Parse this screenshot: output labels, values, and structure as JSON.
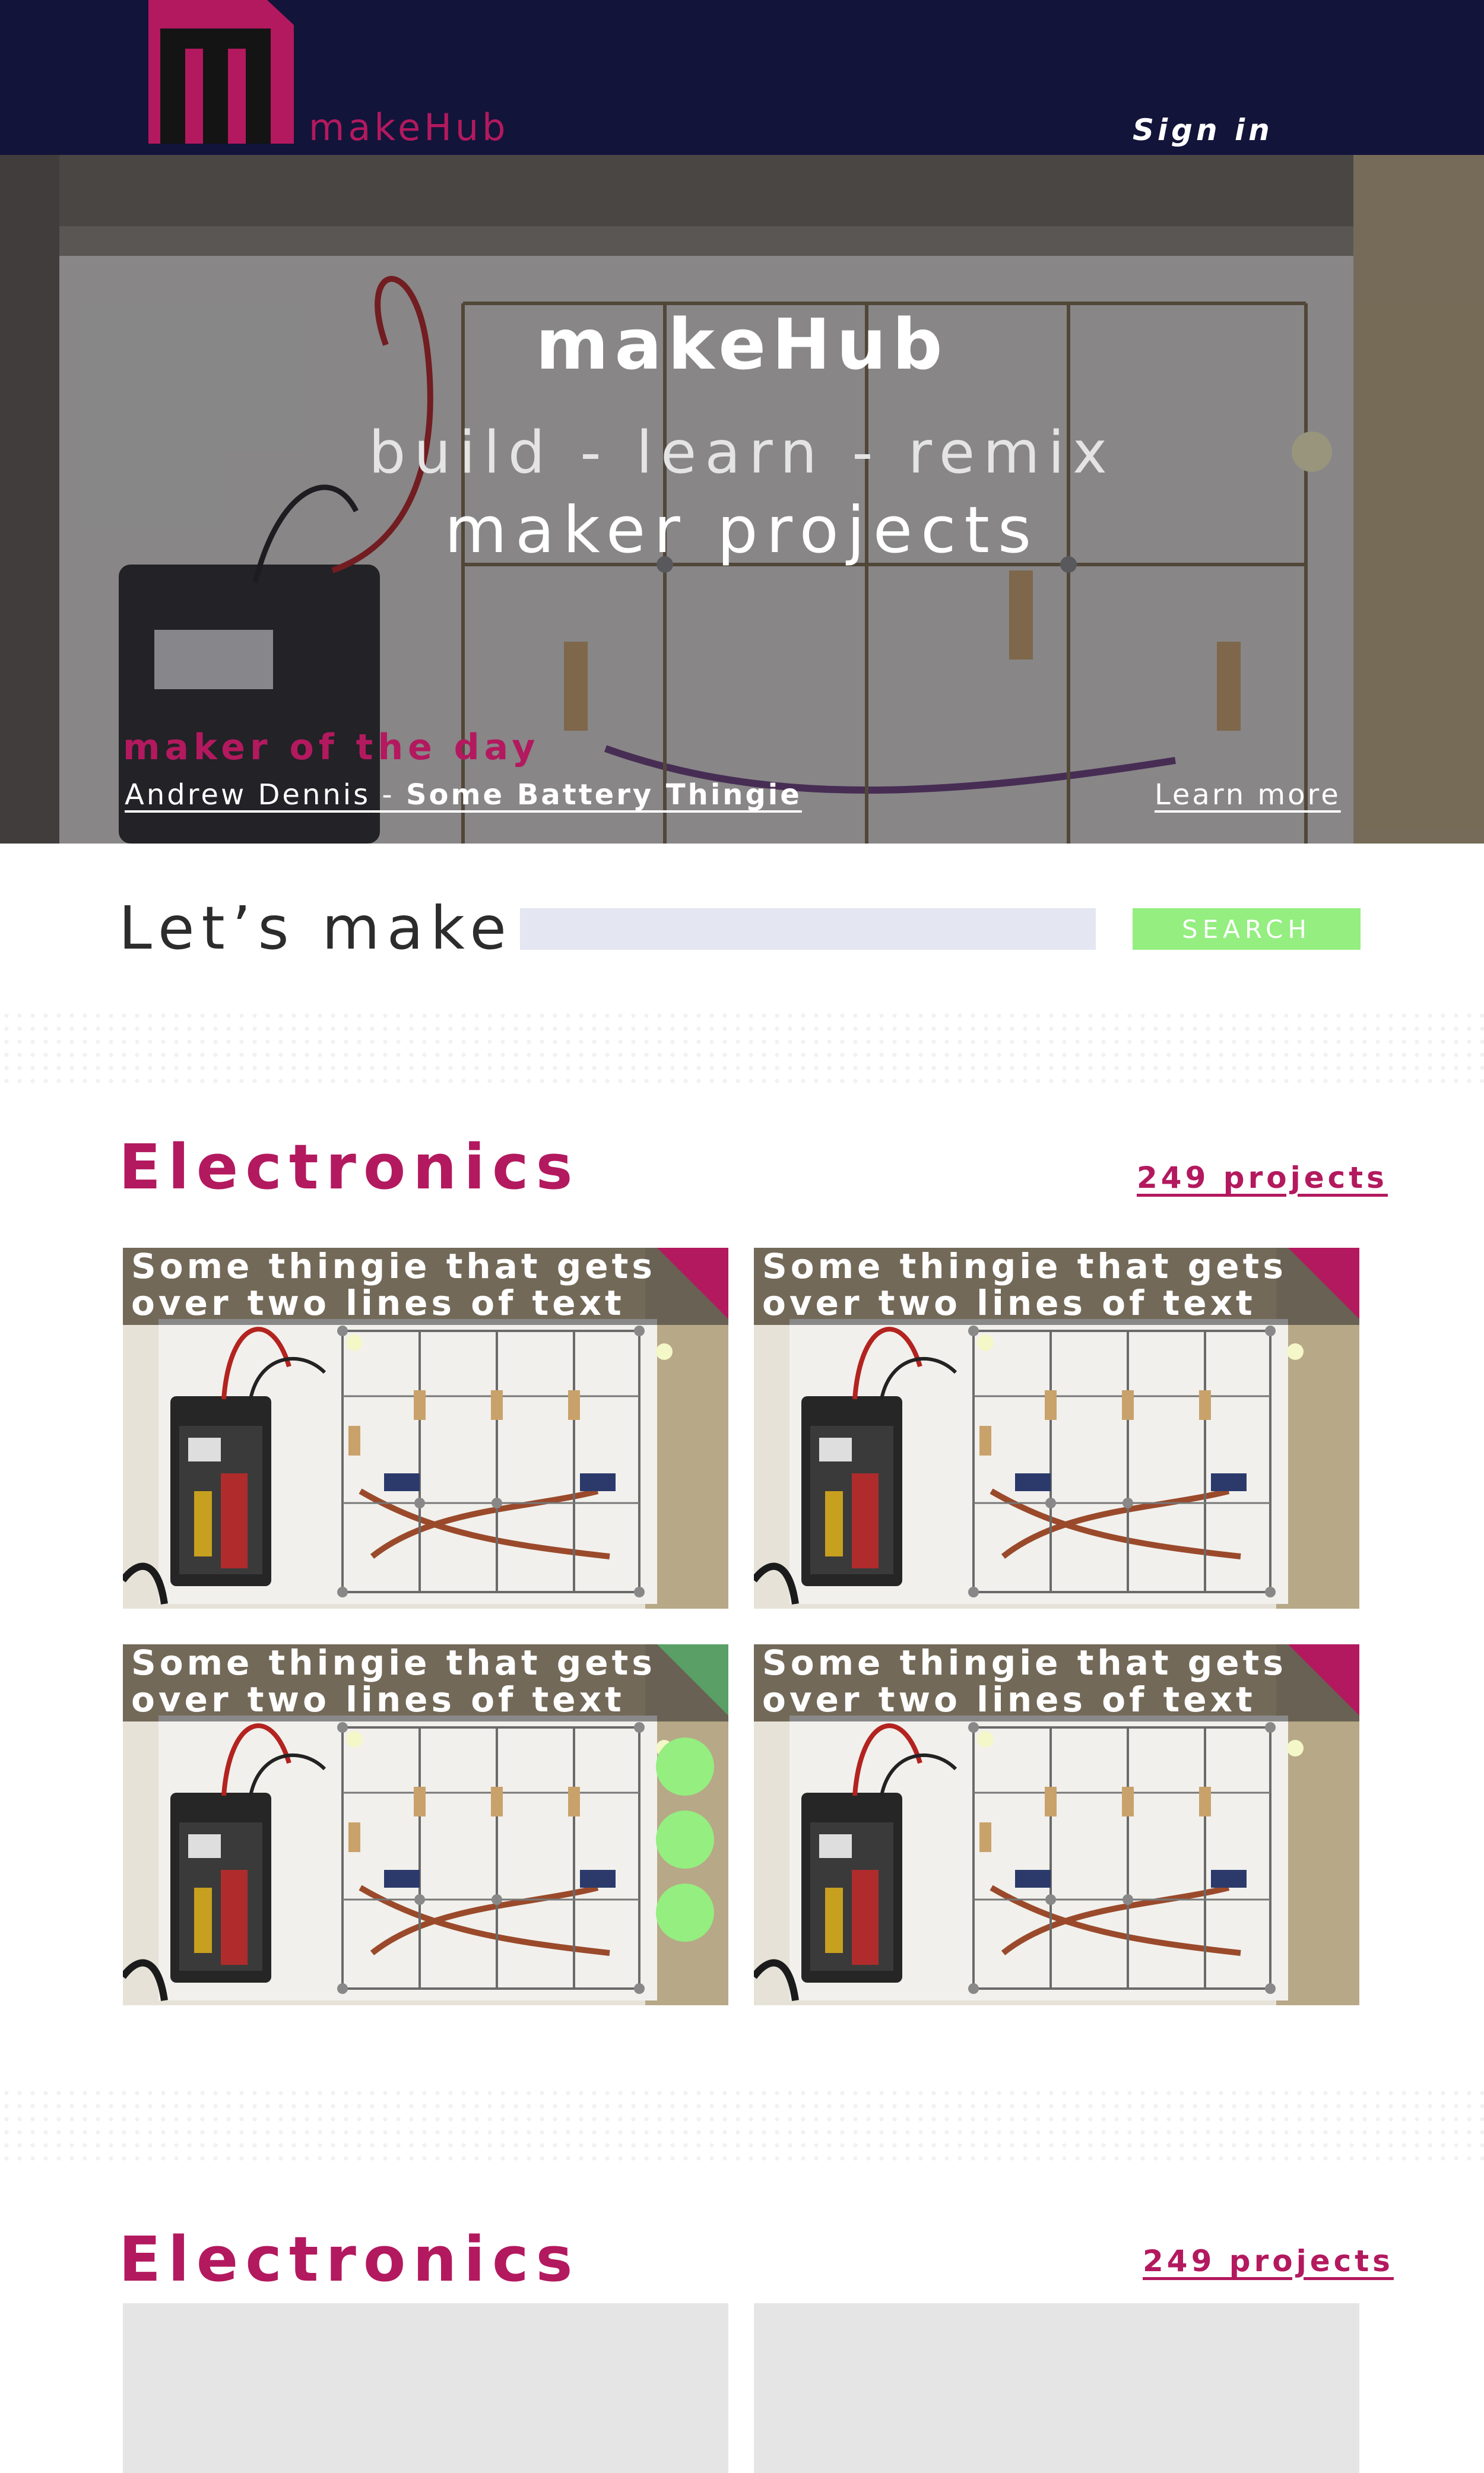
{
  "header": {
    "logo_text": "makeHub",
    "signin_label": "Sign in",
    "colors": {
      "background": "#12143a",
      "brand": "#b3195e"
    }
  },
  "hero": {
    "title": "makeHub",
    "tagline": "build - learn - remix",
    "subtitle": "maker projects",
    "maker_of_the_day": {
      "label": "maker of the day",
      "author": "Andrew Dennis",
      "separator": " - ",
      "project": "Some Battery Thingie"
    },
    "learn_more_label": "Learn more"
  },
  "search": {
    "label": "Let’s make",
    "value": "",
    "button_label": "SEARCH",
    "colors": {
      "input": "#e4e6f1",
      "button": "#94ee80"
    }
  },
  "sections": [
    {
      "title": "Electronics",
      "count_label": "249 projects",
      "cards": [
        {
          "title_line1": "Some thingie that gets",
          "title_line2": "over two lines of text",
          "image": "circuit-board-photo",
          "corner_color": "#b3195e"
        },
        {
          "title_line1": "Some thingie that gets",
          "title_line2": "over two lines of text",
          "image": "circuit-board-photo",
          "corner_color": "#b3195e"
        },
        {
          "title_line1": "Some thingie that gets",
          "title_line2": "over two lines of text",
          "image": "circuit-board-photo",
          "corner_color": "#5aa066",
          "action_dots": 3
        },
        {
          "title_line1": "Some thingie that gets",
          "title_line2": "over two lines of text",
          "image": "circuit-board-photo",
          "corner_color": "#b3195e"
        }
      ]
    },
    {
      "title": "Electronics",
      "count_label": "249 projects",
      "cards": []
    }
  ],
  "accent_colors": {
    "brand": "#b3195e",
    "action": "#94ee80"
  }
}
